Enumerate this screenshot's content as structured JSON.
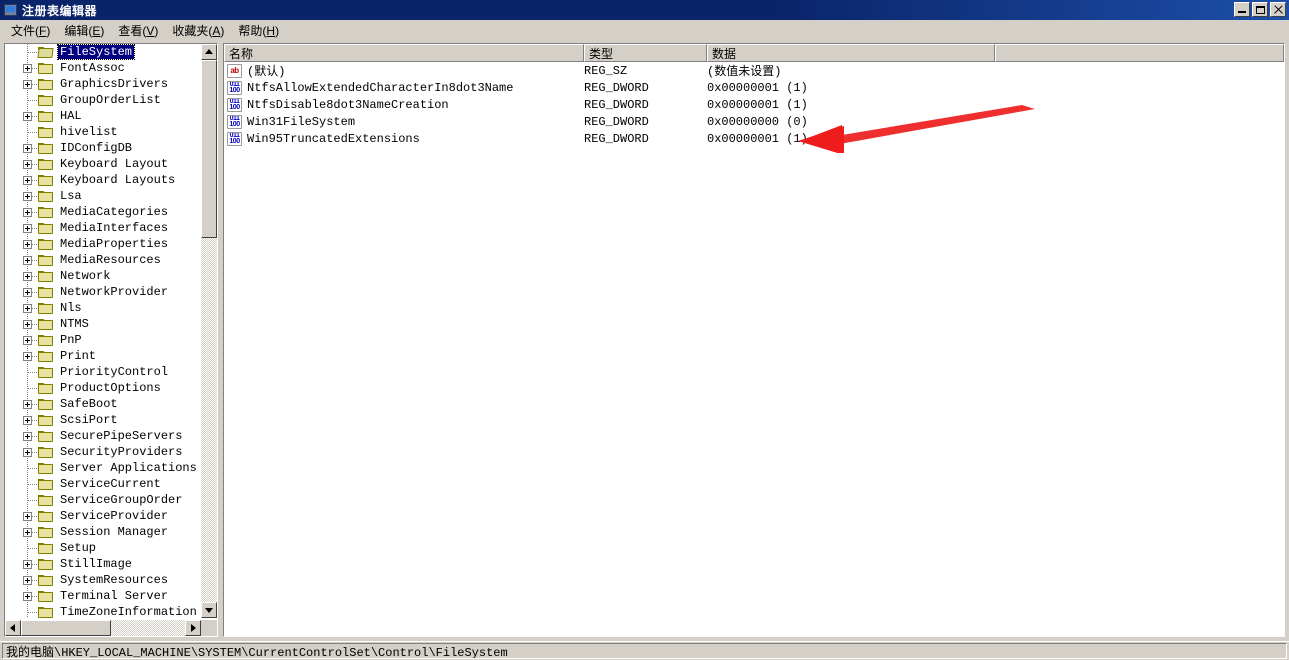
{
  "window": {
    "title": "注册表编辑器",
    "icon": "registry-editor-icon",
    "minimize_label": "最小化",
    "maximize_label": "最大化",
    "close_label": "关闭"
  },
  "menu": {
    "items": [
      {
        "text": "文件",
        "mnemonic": "F"
      },
      {
        "text": "编辑",
        "mnemonic": "E"
      },
      {
        "text": "查看",
        "mnemonic": "V"
      },
      {
        "text": "收藏夹",
        "mnemonic": "A"
      },
      {
        "text": "帮助",
        "mnemonic": "H"
      }
    ]
  },
  "tree": {
    "nodes": [
      {
        "label": "FileSystem",
        "expandable": false,
        "selected": true,
        "open": true
      },
      {
        "label": "FontAssoc",
        "expandable": true,
        "selected": false,
        "open": false
      },
      {
        "label": "GraphicsDrivers",
        "expandable": true,
        "selected": false,
        "open": false
      },
      {
        "label": "GroupOrderList",
        "expandable": false,
        "selected": false,
        "open": false
      },
      {
        "label": "HAL",
        "expandable": true,
        "selected": false,
        "open": false
      },
      {
        "label": "hivelist",
        "expandable": false,
        "selected": false,
        "open": false
      },
      {
        "label": "IDConfigDB",
        "expandable": true,
        "selected": false,
        "open": false
      },
      {
        "label": "Keyboard Layout",
        "expandable": true,
        "selected": false,
        "open": false
      },
      {
        "label": "Keyboard Layouts",
        "expandable": true,
        "selected": false,
        "open": false
      },
      {
        "label": "Lsa",
        "expandable": true,
        "selected": false,
        "open": false
      },
      {
        "label": "MediaCategories",
        "expandable": true,
        "selected": false,
        "open": false
      },
      {
        "label": "MediaInterfaces",
        "expandable": true,
        "selected": false,
        "open": false
      },
      {
        "label": "MediaProperties",
        "expandable": true,
        "selected": false,
        "open": false
      },
      {
        "label": "MediaResources",
        "expandable": true,
        "selected": false,
        "open": false
      },
      {
        "label": "Network",
        "expandable": true,
        "selected": false,
        "open": false
      },
      {
        "label": "NetworkProvider",
        "expandable": true,
        "selected": false,
        "open": false
      },
      {
        "label": "Nls",
        "expandable": true,
        "selected": false,
        "open": false
      },
      {
        "label": "NTMS",
        "expandable": true,
        "selected": false,
        "open": false
      },
      {
        "label": "PnP",
        "expandable": true,
        "selected": false,
        "open": false
      },
      {
        "label": "Print",
        "expandable": true,
        "selected": false,
        "open": false
      },
      {
        "label": "PriorityControl",
        "expandable": false,
        "selected": false,
        "open": false
      },
      {
        "label": "ProductOptions",
        "expandable": false,
        "selected": false,
        "open": false
      },
      {
        "label": "SafeBoot",
        "expandable": true,
        "selected": false,
        "open": false
      },
      {
        "label": "ScsiPort",
        "expandable": true,
        "selected": false,
        "open": false
      },
      {
        "label": "SecurePipeServers",
        "expandable": true,
        "selected": false,
        "open": false
      },
      {
        "label": "SecurityProviders",
        "expandable": true,
        "selected": false,
        "open": false
      },
      {
        "label": "Server Applications",
        "expandable": false,
        "selected": false,
        "open": false
      },
      {
        "label": "ServiceCurrent",
        "expandable": false,
        "selected": false,
        "open": false
      },
      {
        "label": "ServiceGroupOrder",
        "expandable": false,
        "selected": false,
        "open": false
      },
      {
        "label": "ServiceProvider",
        "expandable": true,
        "selected": false,
        "open": false
      },
      {
        "label": "Session Manager",
        "expandable": true,
        "selected": false,
        "open": false
      },
      {
        "label": "Setup",
        "expandable": false,
        "selected": false,
        "open": false
      },
      {
        "label": "StillImage",
        "expandable": true,
        "selected": false,
        "open": false
      },
      {
        "label": "SystemResources",
        "expandable": true,
        "selected": false,
        "open": false
      },
      {
        "label": "Terminal Server",
        "expandable": true,
        "selected": false,
        "open": false
      },
      {
        "label": "TimeZoneInformation",
        "expandable": false,
        "selected": false,
        "open": false
      }
    ]
  },
  "list": {
    "columns": [
      {
        "label": "名称"
      },
      {
        "label": "类型"
      },
      {
        "label": "数据"
      },
      {
        "label": ""
      }
    ],
    "rows": [
      {
        "name": "(默认)",
        "type": "REG_SZ",
        "data": "(数值未设置)",
        "icon": "string-value-icon"
      },
      {
        "name": "NtfsAllowExtendedCharacterIn8dot3Name",
        "type": "REG_DWORD",
        "data": "0x00000001 (1)",
        "icon": "dword-value-icon"
      },
      {
        "name": "NtfsDisable8dot3NameCreation",
        "type": "REG_DWORD",
        "data": "0x00000001 (1)",
        "icon": "dword-value-icon"
      },
      {
        "name": "Win31FileSystem",
        "type": "REG_DWORD",
        "data": "0x00000000 (0)",
        "icon": "dword-value-icon"
      },
      {
        "name": "Win95TruncatedExtensions",
        "type": "REG_DWORD",
        "data": "0x00000001 (1)",
        "icon": "dword-value-icon"
      }
    ]
  },
  "status": {
    "path": "我的电脑\\HKEY_LOCAL_MACHINE\\SYSTEM\\CurrentControlSet\\Control\\FileSystem"
  },
  "annotation": {
    "type": "arrow",
    "color": "#ee1c1c",
    "points_to_row": "NtfsDisable8dot3NameCreation",
    "direction": "left"
  },
  "colors": {
    "title_bar": "#0a246a",
    "window_face": "#d4d0c8",
    "selection": "#000080",
    "annotation_red": "#ee1c1c"
  }
}
